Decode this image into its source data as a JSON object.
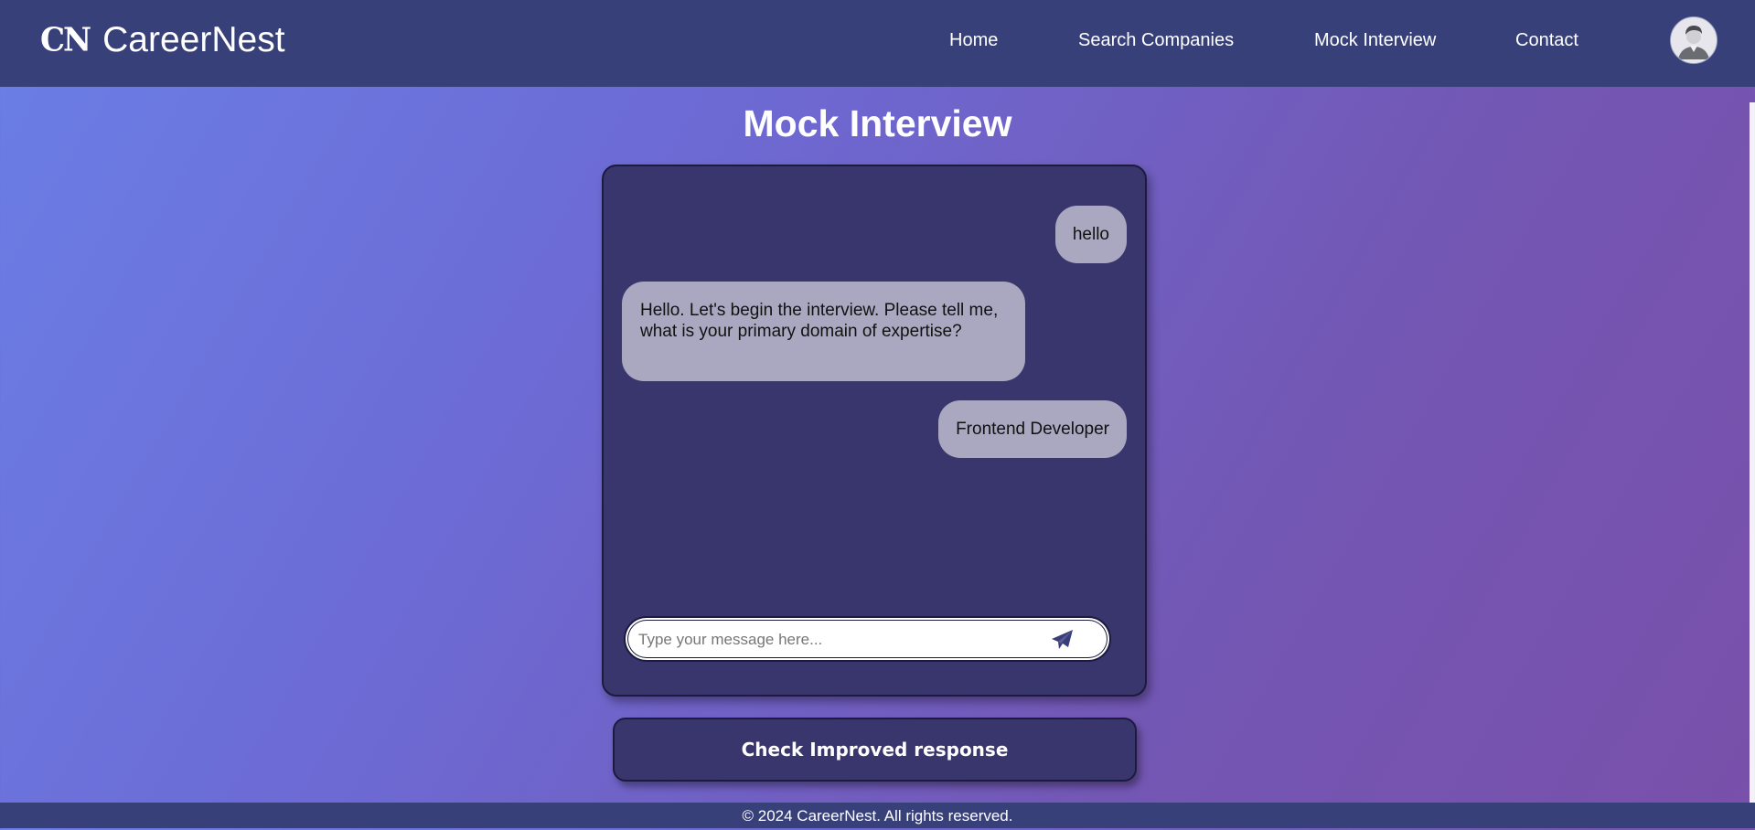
{
  "navbar": {
    "logo_text": "CN",
    "brand_name": "CareerNest",
    "links": [
      {
        "label": "Home"
      },
      {
        "label": "Search Companies"
      },
      {
        "label": "Mock Interview"
      },
      {
        "label": "Contact"
      }
    ],
    "avatar_icon": "user-avatar-icon"
  },
  "page": {
    "title": "Mock Interview"
  },
  "chat": {
    "messages": [
      {
        "role": "user",
        "text": "hello"
      },
      {
        "role": "bot",
        "text": "Hello. Let's begin the interview. Please tell me, what is your primary domain of expertise?"
      },
      {
        "role": "user",
        "text": "Frontend Developer"
      }
    ],
    "input_value": "",
    "input_placeholder": "Type your message here...",
    "send_icon": "paper-plane-icon"
  },
  "actions": {
    "check_improved_label": "Check Improved response"
  },
  "footer": {
    "copyright": "© 2024 CareerNest. All rights reserved."
  },
  "colors": {
    "navbar": "#38407a",
    "panel": "#39366e",
    "bubble": "#aaa8c0"
  }
}
